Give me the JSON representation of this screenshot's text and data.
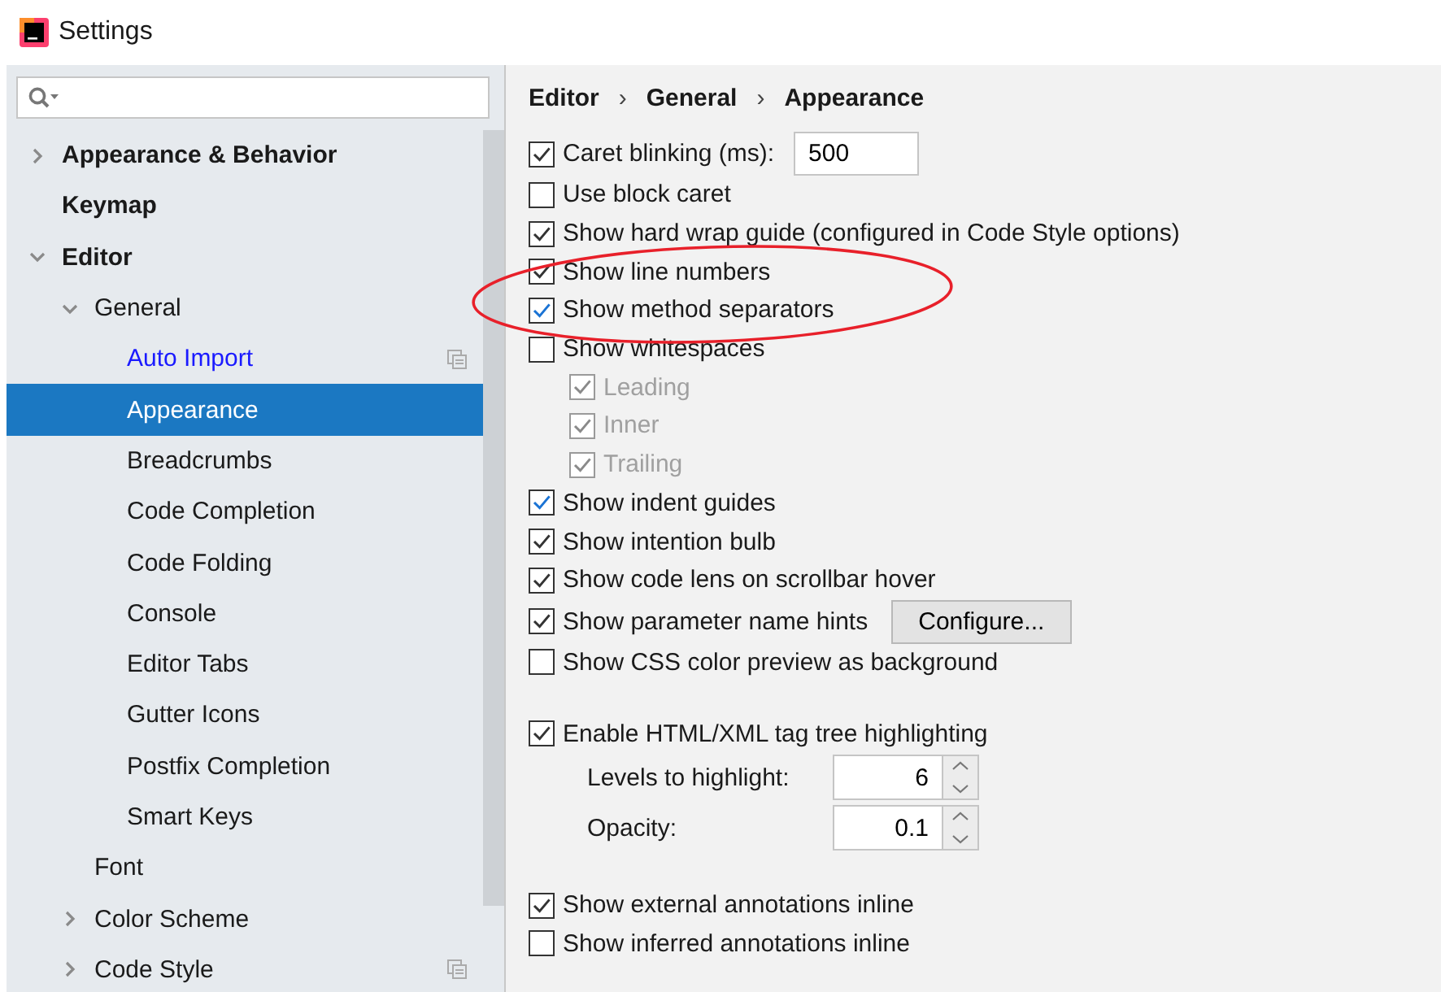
{
  "window": {
    "title": "Settings"
  },
  "sidebar": {
    "tree": [
      {
        "label": "Appearance & Behavior",
        "selected": false,
        "modified": false,
        "project_level": false,
        "expanded": false
      },
      {
        "label": "Keymap",
        "selected": false,
        "modified": false,
        "project_level": false
      },
      {
        "label": "Editor",
        "selected": false,
        "modified": false,
        "project_level": false,
        "expanded": true,
        "children": [
          {
            "label": "General",
            "selected": false,
            "modified": false,
            "project_level": false,
            "expanded": true,
            "children": [
              {
                "label": "Auto Import",
                "selected": false,
                "modified": true,
                "project_level": true
              },
              {
                "label": "Appearance",
                "selected": true,
                "modified": false,
                "project_level": false
              },
              {
                "label": "Breadcrumbs",
                "selected": false,
                "modified": false,
                "project_level": false
              },
              {
                "label": "Code Completion",
                "selected": false,
                "modified": false,
                "project_level": false
              },
              {
                "label": "Code Folding",
                "selected": false,
                "modified": false,
                "project_level": false
              },
              {
                "label": "Console",
                "selected": false,
                "modified": false,
                "project_level": false
              },
              {
                "label": "Editor Tabs",
                "selected": false,
                "modified": false,
                "project_level": false
              },
              {
                "label": "Gutter Icons",
                "selected": false,
                "modified": false,
                "project_level": false
              },
              {
                "label": "Postfix Completion",
                "selected": false,
                "modified": false,
                "project_level": false
              },
              {
                "label": "Smart Keys",
                "selected": false,
                "modified": false,
                "project_level": false
              }
            ]
          },
          {
            "label": "Font",
            "selected": false,
            "modified": false,
            "project_level": false
          },
          {
            "label": "Color Scheme",
            "selected": false,
            "modified": false,
            "project_level": false,
            "expanded": false
          },
          {
            "label": "Code Style",
            "selected": false,
            "modified": false,
            "project_level": true,
            "expanded": false
          }
        ]
      }
    ]
  },
  "breadcrumb": [
    "Editor",
    "General",
    "Appearance"
  ],
  "breadcrumb_separator": "›",
  "option_groups": [
    [
      {
        "kind": "checkbox",
        "label": "Caret blinking (ms):",
        "checked": true,
        "disabled": false,
        "focused": false,
        "field": "500"
      },
      {
        "kind": "checkbox",
        "label": "Use block caret",
        "checked": false,
        "disabled": false
      },
      {
        "kind": "checkbox",
        "label": "Show hard wrap guide (configured in Code Style options)",
        "checked": true,
        "disabled": false,
        "focused": false
      },
      {
        "kind": "checkbox",
        "label": "Show line numbers",
        "checked": true,
        "disabled": false,
        "focused": false
      },
      {
        "kind": "checkbox",
        "label": "Show method separators",
        "checked": true,
        "disabled": false,
        "focused": true
      },
      {
        "kind": "checkbox",
        "label": "Show whitespaces",
        "checked": false,
        "disabled": false,
        "children": [
          {
            "kind": "checkbox",
            "label": "Leading",
            "checked": true,
            "disabled": true
          },
          {
            "kind": "checkbox",
            "label": "Inner",
            "checked": true,
            "disabled": true
          },
          {
            "kind": "checkbox",
            "label": "Trailing",
            "checked": true,
            "disabled": true
          }
        ]
      },
      {
        "kind": "checkbox",
        "label": "Show indent guides",
        "checked": true,
        "disabled": false,
        "focused": true
      },
      {
        "kind": "checkbox",
        "label": "Show intention bulb",
        "checked": true,
        "disabled": false,
        "focused": false
      },
      {
        "kind": "checkbox",
        "label": "Show code lens on scrollbar hover",
        "checked": true,
        "disabled": false,
        "focused": false
      },
      {
        "kind": "checkbox",
        "label": "Show parameter name hints",
        "checked": true,
        "disabled": false,
        "focused": false,
        "button": "Configure..."
      },
      {
        "kind": "checkbox",
        "label": "Show CSS color preview as background",
        "checked": false,
        "disabled": false
      }
    ],
    [
      {
        "kind": "checkbox",
        "label": "Enable HTML/XML tag tree highlighting",
        "checked": true,
        "disabled": false,
        "focused": false,
        "children": [
          {
            "kind": "spinner",
            "label": "Levels to highlight:",
            "value": "6"
          },
          {
            "kind": "spinner",
            "label": "Opacity:",
            "value": "0.1"
          }
        ]
      }
    ],
    [
      {
        "kind": "checkbox",
        "label": "Show external annotations inline",
        "checked": true,
        "disabled": false,
        "focused": false
      },
      {
        "kind": "checkbox",
        "label": "Show inferred annotations inline",
        "checked": false,
        "disabled": false
      }
    ]
  ]
}
